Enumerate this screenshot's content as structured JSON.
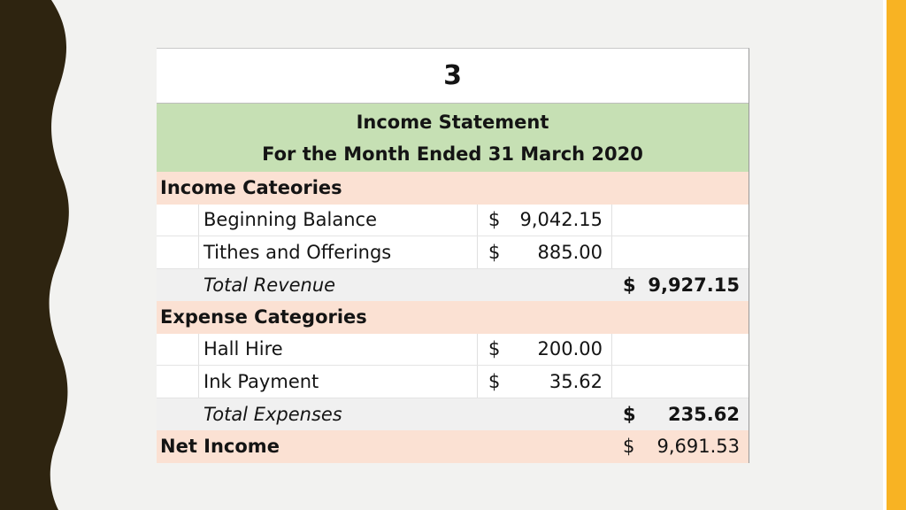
{
  "page_number": "3",
  "header": {
    "title": "Income Statement",
    "subtitle": "For the Month Ended 31 March 2020"
  },
  "income": {
    "section_label": "Income Cateories",
    "items": [
      {
        "label": "Beginning Balance",
        "currency": "$",
        "amount": "9,042.15"
      },
      {
        "label": "Tithes and Offerings",
        "currency": "$",
        "amount": "885.00"
      }
    ],
    "total_label": "Total Revenue",
    "total_currency": "$",
    "total_amount": "9,927.15"
  },
  "expenses": {
    "section_label": "Expense Categories",
    "items": [
      {
        "label": "Hall Hire",
        "currency": "$",
        "amount": "200.00"
      },
      {
        "label": "Ink Payment",
        "currency": "$",
        "amount": "35.62"
      }
    ],
    "total_label": "Total Expenses",
    "total_currency": "$",
    "total_amount": "235.62"
  },
  "net_income": {
    "label": "Net Income",
    "currency": "$",
    "amount": "9,691.53"
  },
  "colors": {
    "header_band": "#c6e0b4",
    "section_band": "#fbe1d3",
    "accent_stripe": "#f8b323",
    "left_wave": "#2e2410"
  }
}
